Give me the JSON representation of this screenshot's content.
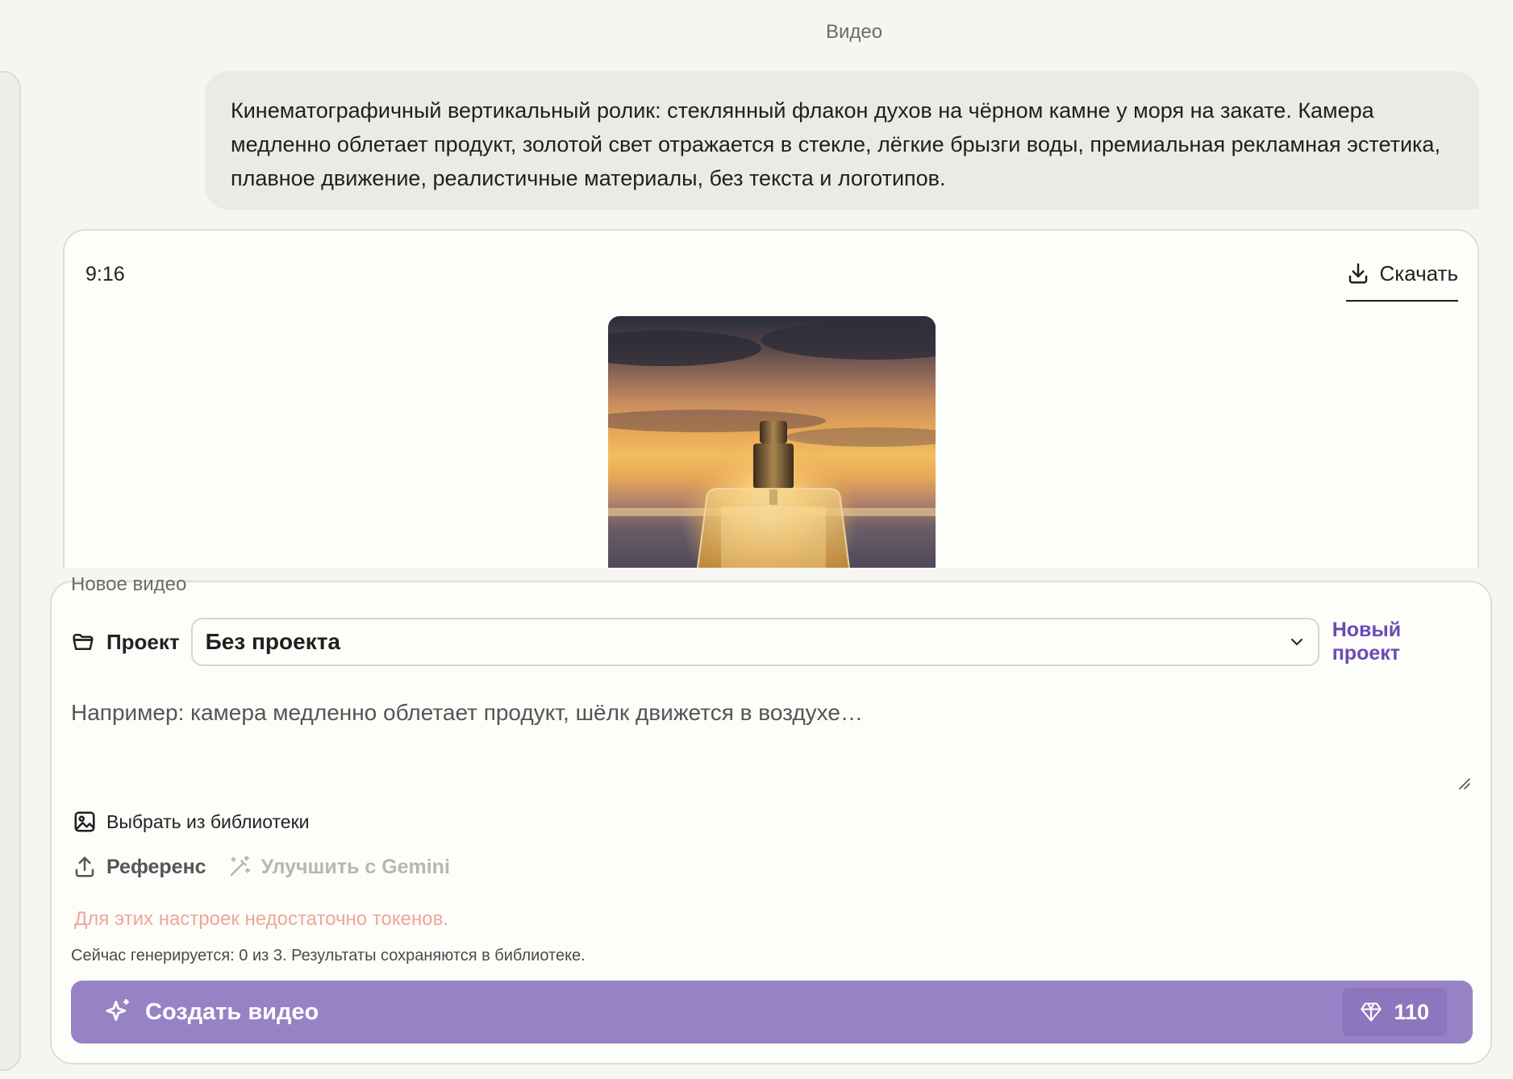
{
  "header": {
    "section_title": "Видео"
  },
  "message": {
    "prompt_text": "Кинематографичный вертикальный ролик: стеклянный флакон духов на чёрном камне у моря на закате. Камера медленно облетает продукт, золотой свет отражается в стекле, лёгкие брызги воды, премиальная рекламная эстетика, плавное движение, реалистичные материалы, без текста и логотипов."
  },
  "result": {
    "aspect_ratio": "9:16",
    "download_label": "Скачать",
    "download_icon": "download-icon"
  },
  "composer": {
    "label": "Новое видео",
    "project_label": "Проект",
    "project_value": "Без проекта",
    "new_project_label": "Новый проект",
    "prompt_placeholder": "Например: камера медленно облетает продукт, шёлк движется в воздухе…",
    "library_label": "Выбрать из библиотеки",
    "reference_label": "Референс",
    "gemini_label": "Улучшить с Gemini",
    "warning_text": "Для этих настроек недостаточно токенов.",
    "status_text": "Сейчас генерируется: 0 из 3. Результаты сохраняются в библиотеке.",
    "create_label": "Создать видео",
    "cost": "110"
  },
  "colors": {
    "accent": "#9882c6",
    "link": "#6b4bb5",
    "warning": "#f0a597"
  }
}
